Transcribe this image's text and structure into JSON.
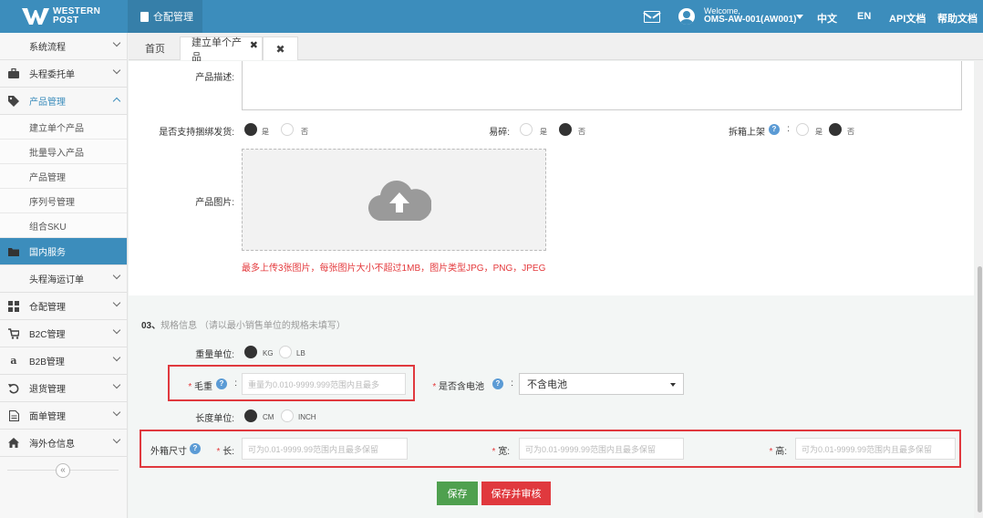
{
  "header": {
    "logo_line1": "WESTERN",
    "logo_line2": "POST",
    "module": "仓配管理",
    "welcome": "Welcome,",
    "account": "OMS-AW-001(AW001)",
    "lang_zh": "中文",
    "lang_en": "EN",
    "api_docs": "API文档",
    "help_docs": "帮助文档"
  },
  "sidebar": {
    "items": [
      {
        "label": "系统流程",
        "icon": "none"
      },
      {
        "label": "头程委托单",
        "icon": "briefcase-icon"
      },
      {
        "label": "产品管理",
        "icon": "tag-icon"
      },
      {
        "label": "国内服务",
        "icon": "folder-icon"
      },
      {
        "label": "头程海运订单",
        "icon": "none"
      },
      {
        "label": "仓配管理",
        "icon": "grid-icon"
      },
      {
        "label": "B2C管理",
        "icon": "cart-icon"
      },
      {
        "label": "B2B管理",
        "icon": "amazon-icon"
      },
      {
        "label": "退货管理",
        "icon": "return-icon"
      },
      {
        "label": "面单管理",
        "icon": "document-icon"
      },
      {
        "label": "海外仓信息",
        "icon": "home-icon"
      }
    ],
    "product_sub": [
      "建立单个产品",
      "批量导入产品",
      "产品管理",
      "序列号管理",
      "组合SKU"
    ]
  },
  "tabs": {
    "home": "首页",
    "current": "建立单个产品"
  },
  "form": {
    "desc_label": "产品描述:",
    "bundle_label": "是否支持捆绑发货:",
    "fragile_label": "易碎:",
    "unbox_label": "拆箱上架",
    "yes": "是",
    "no": "否",
    "image_label": "产品图片:",
    "upload_note": "最多上传3张图片，每张图片大小不超过1MB，图片类型JPG，PNG，JPEG",
    "bundle_value": "是",
    "fragile_value": "否",
    "unbox_value": "否"
  },
  "spec": {
    "section_num": "03、",
    "section_title": "规格信息",
    "section_hint": "（请以最小销售单位的规格未填写）",
    "weight_unit_label": "重量单位:",
    "weight_units": [
      "KG",
      "LB"
    ],
    "weight_unit_value": "KG",
    "gross_weight_label": "毛重",
    "gross_weight_placeholder": "重量为0.010-9999.999范围内且最多",
    "battery_label": "是否含电池",
    "battery_value": "不含电池",
    "length_unit_label": "长度单位:",
    "length_units": [
      "CM",
      "INCH"
    ],
    "length_unit_value": "CM",
    "outer_box_label": "外箱尺寸",
    "length_label": "长:",
    "width_label": "宽:",
    "height_label": "高:",
    "dim_placeholder": "可为0.01-9999.99范围内且最多保留"
  },
  "buttons": {
    "save": "保存",
    "save_audit": "保存并审核"
  },
  "colors": {
    "header": "#3c8dbc",
    "required": "#e4393c",
    "save": "#4fa04f",
    "save_audit": "#e0393e"
  }
}
